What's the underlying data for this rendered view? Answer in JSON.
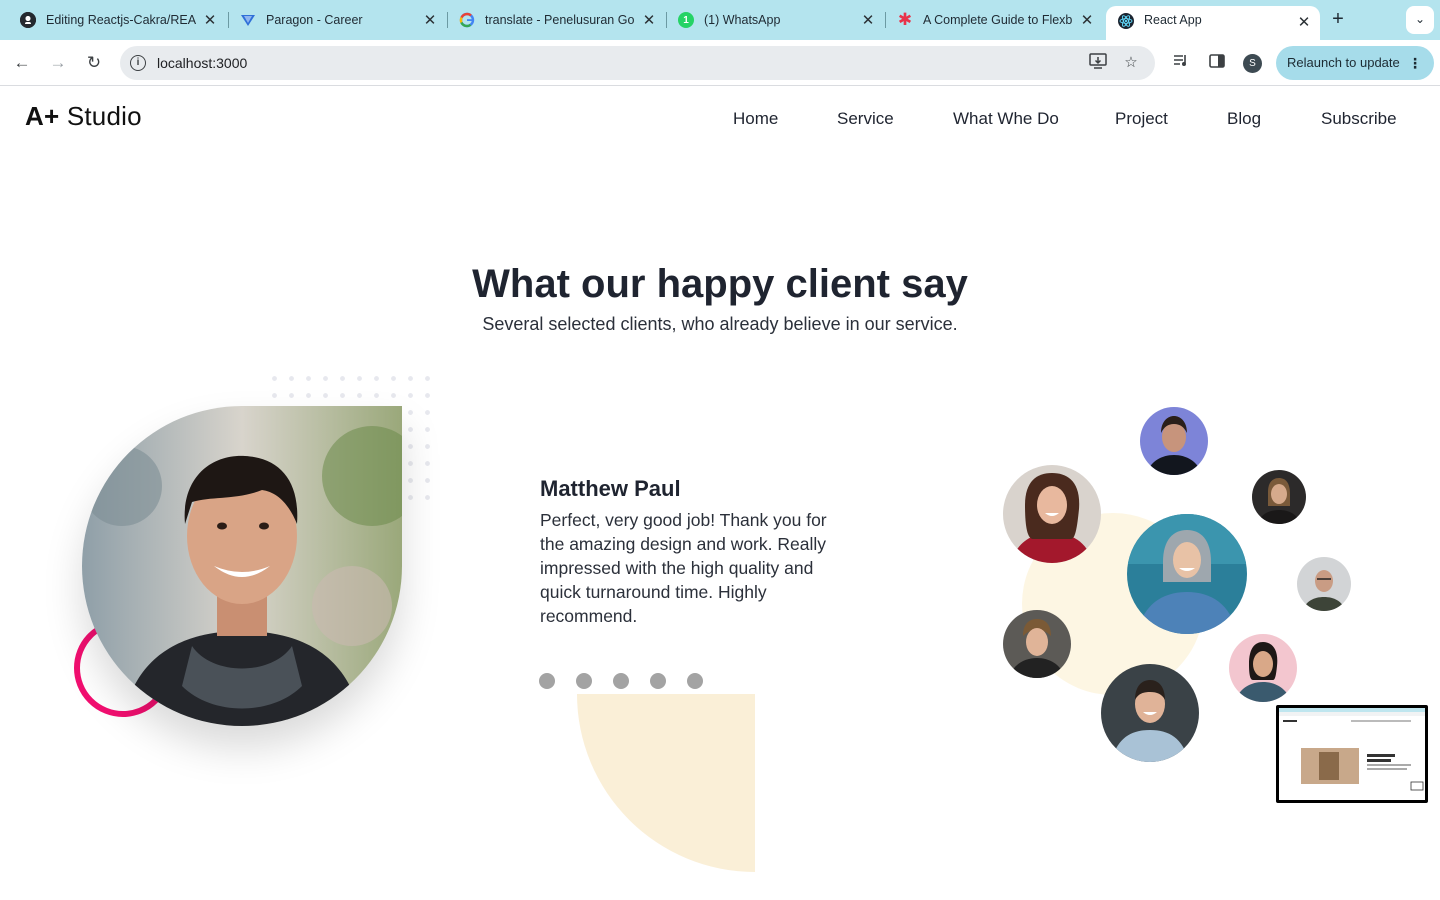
{
  "browser": {
    "tabs": [
      {
        "title": "Editing Reactjs-Cakra/REA",
        "favicon": "github-icon",
        "active": false
      },
      {
        "title": "Paragon - Career",
        "favicon": "paragon-icon",
        "active": false
      },
      {
        "title": "translate - Penelusuran Go",
        "favicon": "google-icon",
        "active": false
      },
      {
        "title": "(1) WhatsApp",
        "favicon": "whatsapp-icon",
        "active": false
      },
      {
        "title": "A Complete Guide to Flexb",
        "favicon": "css-tricks-icon",
        "active": false
      },
      {
        "title": "React App",
        "favicon": "react-icon",
        "active": true
      }
    ],
    "url": "localhost:3000",
    "profile_initial": "S",
    "relaunch_label": "Relaunch to update"
  },
  "site": {
    "logo": {
      "bold": "A+",
      "rest": "Studio"
    },
    "nav": [
      "Home",
      "Service",
      "What Whe Do",
      "Project",
      "Blog",
      "Subscribe"
    ]
  },
  "testimonial": {
    "heading": "What our happy client say",
    "subheading": "Several selected clients, who already believe in our service.",
    "client_name": "Matthew Paul",
    "quote": "Perfect, very good job! Thank you for the amazing design and work. Really impressed with the high quality and quick turnaround time. Highly recommend.",
    "slide_count": 5
  },
  "colors": {
    "accent_pink": "#f20f70",
    "cream": "#faefd7",
    "tabstrip": "#b4e4ee",
    "relaunch": "#a6dcea"
  }
}
